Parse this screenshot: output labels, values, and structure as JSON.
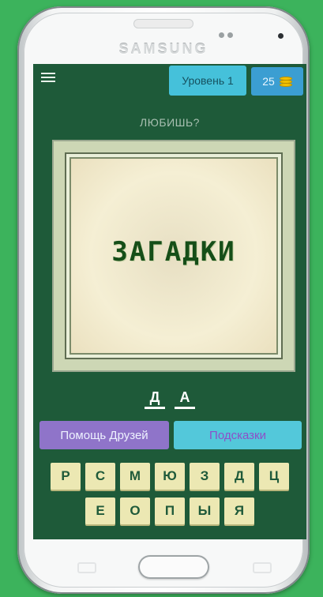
{
  "device": {
    "brand": "SAMSUNG"
  },
  "header": {
    "menu_icon": "hamburger-icon",
    "level_label": "Уровень 1",
    "coins_count": "25",
    "coin_icon": "coin-stack-icon"
  },
  "question": "ЛЮБИШЬ?",
  "picture": {
    "title": "ЗАГАДКИ"
  },
  "answer": {
    "letters": [
      "Д",
      "А"
    ]
  },
  "buttons": {
    "help_friends": "Помощь Друзей",
    "hints": "Подсказки"
  },
  "keyboard": {
    "row1": [
      "Р",
      "С",
      "М",
      "Ю",
      "З",
      "Д",
      "Ц"
    ],
    "row2": [
      "Е",
      "О",
      "П",
      "Ы",
      "Я"
    ]
  },
  "colors": {
    "background": "#3cb35c",
    "screen": "#1e5a39",
    "level_badge": "#45c1da",
    "coins_badge": "#3b9ed2",
    "help_button": "#8f74c9",
    "hint_button": "#53c8da",
    "key": "#ece8b3"
  }
}
